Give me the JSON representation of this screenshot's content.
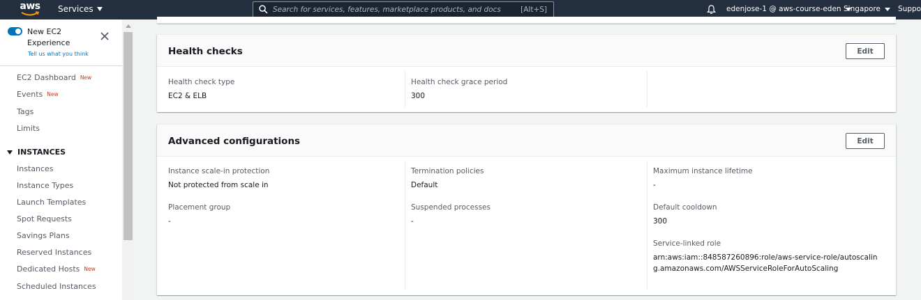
{
  "topnav": {
    "logo": "aws",
    "services_label": "Services",
    "search_placeholder": "Search for services, features, marketplace products, and docs",
    "search_shortcut": "[Alt+S]",
    "account": "edenjose-1 @ aws-course-eden",
    "region": "Singapore",
    "support": "Suppor"
  },
  "sidebar": {
    "toggle_label": "New EC2 Experience",
    "feedback_link": "Tell us what you think",
    "new_badge": "New",
    "items": [
      {
        "label": "EC2 Dashboard",
        "new": true
      },
      {
        "label": "Events",
        "new": true
      },
      {
        "label": "Tags",
        "new": false
      },
      {
        "label": "Limits",
        "new": false
      }
    ],
    "section_title": "INSTANCES",
    "section_items": [
      {
        "label": "Instances",
        "new": false
      },
      {
        "label": "Instance Types",
        "new": false
      },
      {
        "label": "Launch Templates",
        "new": false
      },
      {
        "label": "Spot Requests",
        "new": false
      },
      {
        "label": "Savings Plans",
        "new": false
      },
      {
        "label": "Reserved Instances",
        "new": false
      },
      {
        "label": "Dedicated Hosts",
        "new": true
      },
      {
        "label": "Scheduled Instances",
        "new": false
      }
    ]
  },
  "health_checks": {
    "title": "Health checks",
    "edit_label": "Edit",
    "type_label": "Health check type",
    "type_value": "EC2 & ELB",
    "grace_label": "Health check grace period",
    "grace_value": "300"
  },
  "advanced": {
    "title": "Advanced configurations",
    "edit_label": "Edit",
    "scale_in_label": "Instance scale-in protection",
    "scale_in_value": "Not protected from scale in",
    "termination_label": "Termination policies",
    "termination_value": "Default",
    "max_lifetime_label": "Maximum instance lifetime",
    "max_lifetime_value": "-",
    "placement_label": "Placement group",
    "placement_value": "-",
    "suspended_label": "Suspended processes",
    "suspended_value": "-",
    "cooldown_label": "Default cooldown",
    "cooldown_value": "300",
    "role_label": "Service-linked role",
    "role_value": "arn:aws:iam::848587260896:role/aws-service-role/autoscaling.amazonaws.com/AWSServiceRoleForAutoScaling"
  },
  "colors": {
    "nav_bg": "#232f3e",
    "accent": "#0073bb",
    "new_badge": "#d13212"
  }
}
